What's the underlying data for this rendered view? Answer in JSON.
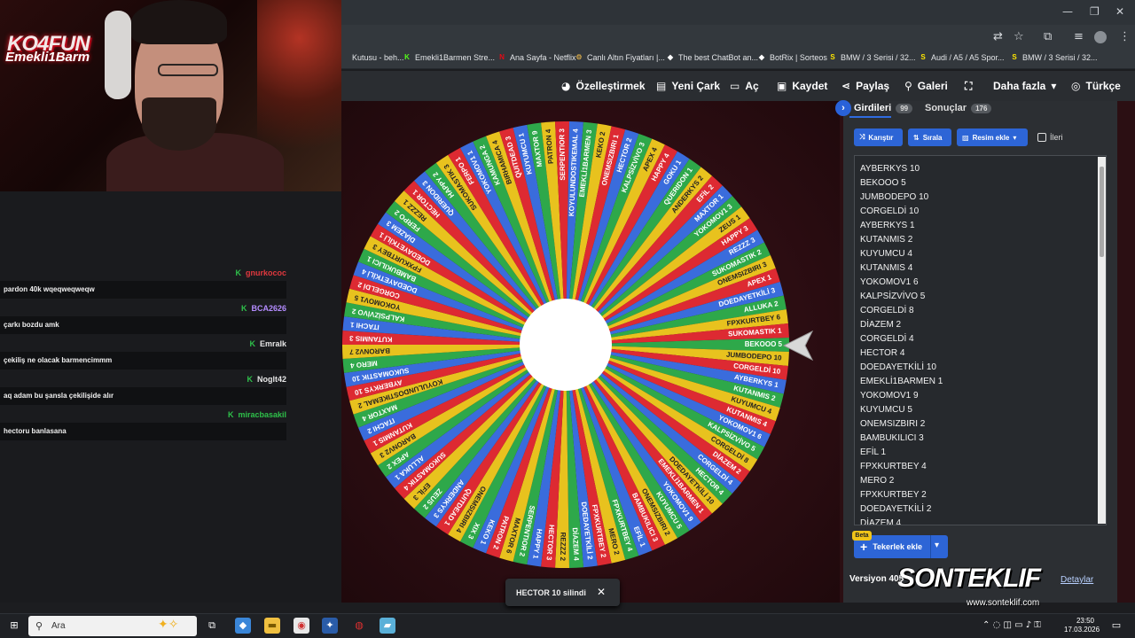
{
  "bookmarks": [
    {
      "label": "Kutusu - beh...",
      "icon": "",
      "color": "#888888"
    },
    {
      "label": "Emekli1Barmen Stre...",
      "icon": "K",
      "color": "#53fc18"
    },
    {
      "label": "Ana Sayfa - Netflix",
      "icon": "N",
      "color": "#e50914"
    },
    {
      "label": "Canlı Altın Fiyatları |...",
      "icon": "⚙",
      "color": "#c8a04a"
    },
    {
      "label": "The best ChatBot an...",
      "icon": "◆",
      "color": "#ffffff"
    },
    {
      "label": "BotRix | Sorteos",
      "icon": "◆",
      "color": "#ffffff"
    },
    {
      "label": "BMW / 3 Serisi / 32...",
      "icon": "S",
      "color": "#ffe600"
    },
    {
      "label": "Audi / A5 / A5 Spor...",
      "icon": "S",
      "color": "#ffe600"
    },
    {
      "label": "BMW / 3 Serisi / 32...",
      "icon": "S",
      "color": "#ffe600"
    }
  ],
  "nav": {
    "customize": "Özelleştirmek",
    "new_wheel": "Yeni Çark",
    "open": "Aç",
    "save": "Kaydet",
    "share": "Paylaş",
    "gallery": "Galeri",
    "more": "Daha fazla",
    "language": "Türkçe"
  },
  "webcam": {
    "logo_line1": "KO4FUN",
    "logo_line2": "Emekli1Barm"
  },
  "chat": [
    {
      "user": "gnurkococ",
      "user_color": "#e0383e",
      "message": "pardon 40k wqeqweqweqw"
    },
    {
      "user": "BCA2626",
      "user_color": "#b48cff",
      "message": "çarkı bozdu amk"
    },
    {
      "user": "Emralk",
      "user_color": "#e6e6e6",
      "message": "çekiliş ne olacak barmencimmm"
    },
    {
      "user": "Noglt42",
      "user_color": "#e6e6e6",
      "message": "aq adam bu şansla çekilişide alır"
    },
    {
      "user": "miracbasakil",
      "user_color": "#2ec04a",
      "message": "hectoru banlasana"
    }
  ],
  "wheel": {
    "colors": [
      "#2ea84a",
      "#e8c21e",
      "#dd2a32",
      "#3a6cdc"
    ],
    "segment_labels": [
      "BEKOOO 5",
      "JUMBODEPO 10",
      "CORGELDİ 10",
      "AYBERKYS 1",
      "KUTANMIS 2",
      "KUYUMCU 4",
      "KUTANMIS 4",
      "YOKOMOV1 6",
      "KALPSİZVİVO 5",
      "CORGELDİ 8",
      "DİAZEM 2",
      "CORGELDİ 4",
      "HECTOR 4",
      "DOEDAYETKİLİ 10",
      "EMEKLİ1BARMEN 1",
      "YOKOMOV1 9",
      "KUYUMCU 5",
      "ONEMSIZBIRI 2",
      "BAMBUKILICI 3",
      "EFİL 1",
      "FPXKURTBEY 4",
      "MERO 2",
      "FPXKURTBEY 2",
      "DOEDAYETKİLİ 2",
      "DİAZEM 4",
      "REZZZ 2",
      "HECTOR 3",
      "HAPPY 1",
      "SERPENTIOR 2",
      "MAXTOR 6",
      "PATRON 2",
      "KEKO 1",
      "XIX 3",
      "ONEMSIZBIRI 4",
      "QUITDEAD 1",
      "ANDERKYS 3",
      "ZEUS 2",
      "EFİL 3",
      "SUKOMASTIK 4",
      "ALLUKA 1",
      "APEX 2",
      "BARONV2 3",
      "KUTANMIS 1",
      "ITACHI 2",
      "MAXTOR 4",
      "KOYULUNDOSTIKEMAL 2",
      "AYBERKYS 10",
      "SUKOMASTIK 10",
      "MERO 4",
      "BARONV2 7",
      "KUTANMIS 3",
      "ITACHI 1",
      "KALPSİZVİVO 2",
      "YOKOMOV1 5",
      "CORGELDİ 2",
      "DOEDAYETKİLİ 4",
      "BAMBUKILICI 1",
      "FPXKURTBEY 3",
      "DOEDAYETKİLİ 1",
      "DİAZEM 3",
      "FERPO 2",
      "REZZZ 1",
      "HECTOR 1",
      "QUERIDON 3",
      "HAPPY 2",
      "SUKOMASTIK 3",
      "FERPO 1",
      "YOKOMOV1 1",
      "KAMUNGA 2",
      "BIRHAMICA 4",
      "QUITDEAD 3",
      "KUYUMCU 1",
      "MAXTOR 9",
      "PATRON 4",
      "SERPENTIOR 3",
      "KOYULUNDOSTIKEMAL 4",
      "EMEKLİ1BARMEN 3",
      "KEKO 2",
      "ONEMSIZBIRI 1",
      "HECTOR 2",
      "KALPSİZVİVO 3",
      "APEX 4",
      "HAPPY 4",
      "GOKU 1",
      "QUERIDON 1",
      "ANDERKYS 2",
      "EFİL 2",
      "MAXTOR 1",
      "YOKOMOV1 3",
      "ZEUS 1",
      "HAPPY 3",
      "REZZZ 3",
      "SUKOMASTIK 2",
      "ONEMSIZBIRI 3",
      "APEX 1",
      "DOEDAYETKİLİ 3",
      "ALLUKA 2",
      "FPXKURTBEY 6",
      "SUKOMASTIK 1"
    ]
  },
  "panel": {
    "tab_entries": "Girdileri",
    "tab_entries_count": "99",
    "tab_results": "Sonuçlar",
    "tab_results_count": "176",
    "shuffle": "Karıştır",
    "sort": "Sırala",
    "add_image": "Resim ekle",
    "advanced": "İleri",
    "entries": [
      "AYBERKYS 10",
      "BEKOOO 5",
      "JUMBODEPO 10",
      "CORGELDİ 10",
      "AYBERKYS 1",
      "KUTANMIS 2",
      "KUYUMCU 4",
      "KUTANMIS 4",
      "YOKOMOV1 6",
      "KALPSİZVİVO 5",
      "CORGELDİ 8",
      "DİAZEM 2",
      "CORGELDİ 4",
      "HECTOR 4",
      "DOEDAYETKİLİ 10",
      "EMEKLİ1BARMEN 1",
      "YOKOMOV1 9",
      "KUYUMCU 5",
      "ONEMSIZBIRI 2",
      "BAMBUKILICI 3",
      "EFİL 1",
      "FPXKURTBEY 4",
      "MERO 2",
      "FPXKURTBEY 2",
      "DOEDAYETKİLİ 2",
      "DİAZEM 4"
    ],
    "beta": "Beta",
    "add_wheels": "Tekerlek ekle",
    "version": "Versiyon 405",
    "details": "Detaylar"
  },
  "overlay": {
    "brand": "SONTEKLIF",
    "url": "www.sonteklif.com"
  },
  "toast": {
    "text": "HECTOR 10 silindi"
  },
  "taskbar": {
    "search_placeholder": "Ara",
    "time": "23:50",
    "date": "17.03.2026"
  }
}
